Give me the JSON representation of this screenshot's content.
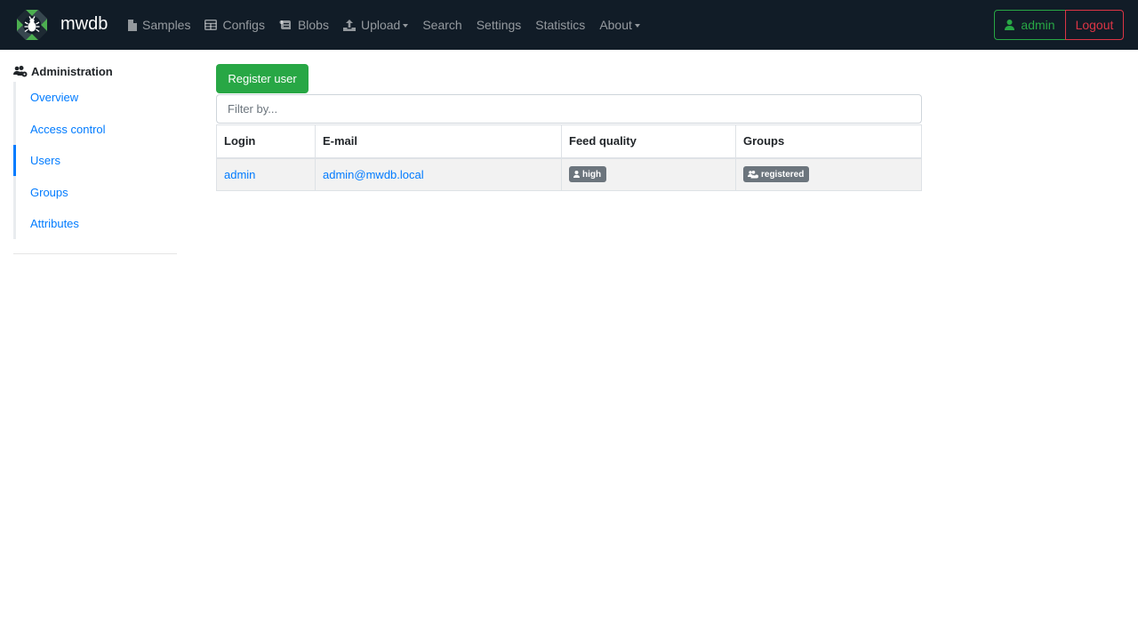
{
  "app": {
    "brand": "mwdb"
  },
  "nav": {
    "items": [
      {
        "label": "Samples",
        "icon": "file-icon"
      },
      {
        "label": "Configs",
        "icon": "table-icon"
      },
      {
        "label": "Blobs",
        "icon": "scroll-icon"
      },
      {
        "label": "Upload",
        "icon": "upload-icon",
        "dropdown": true
      },
      {
        "label": "Search"
      },
      {
        "label": "Settings"
      },
      {
        "label": "Statistics"
      },
      {
        "label": "About",
        "dropdown": true
      }
    ],
    "user_label": "admin",
    "logout_label": "Logout"
  },
  "sidebar": {
    "title": "Administration",
    "items": [
      {
        "label": "Overview"
      },
      {
        "label": "Access control"
      },
      {
        "label": "Users",
        "active": true
      },
      {
        "label": "Groups"
      },
      {
        "label": "Attributes"
      }
    ]
  },
  "main": {
    "register_button": "Register user",
    "filter_placeholder": "Filter by...",
    "table": {
      "columns": [
        "Login",
        "E-mail",
        "Feed quality",
        "Groups"
      ],
      "rows": [
        {
          "login": "admin",
          "email": "admin@mwdb.local",
          "feed_quality": "high",
          "groups": "registered"
        }
      ]
    }
  },
  "colors": {
    "navbar_bg": "#111c27",
    "link": "#007bff",
    "success": "#28a745",
    "danger": "#dc3545",
    "badge": "#6c757d"
  }
}
